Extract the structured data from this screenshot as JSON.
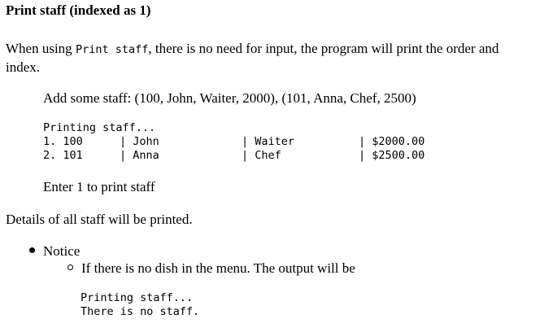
{
  "heading": "Print staff (indexed as 1)",
  "intro": {
    "pre": "When using ",
    "code": "Print staff",
    "post": ", there is no need for input, the program will print the order and index."
  },
  "example_add": "Add some staff: (100, John, Waiter, 2000), (101, Anna, Chef, 2500)",
  "output_block": {
    "header": "Printing staff...",
    "rows": [
      [
        "1. 100",
        "| John",
        "| Waiter",
        "| $2000.00"
      ],
      [
        "2. 101",
        "| Anna",
        "| Chef",
        "| $2500.00"
      ]
    ]
  },
  "enter_instruction": "Enter 1 to print staff",
  "details_line": "Details of all staff will be printed.",
  "notice": {
    "label": "Notice",
    "sub_item": "If there is no dish in the menu. The output will be",
    "empty_output": [
      "Printing staff...",
      "There is no staff."
    ]
  }
}
